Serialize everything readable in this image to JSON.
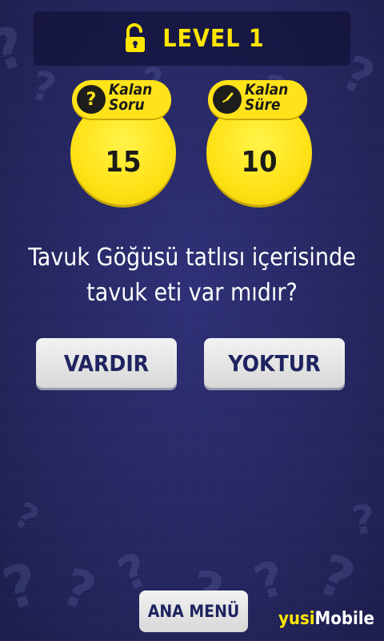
{
  "header": {
    "level_label": "LEVEL 1",
    "icon": "unlocked-padlock-icon"
  },
  "stats": {
    "questions": {
      "label_line1": "Kalan",
      "label_line2": "Soru",
      "icon": "question-mark-icon",
      "value": "15"
    },
    "time": {
      "label_line1": "Kalan",
      "label_line2": "Süre",
      "icon": "clock-icon",
      "value": "10"
    }
  },
  "question": {
    "line1": "Tavuk Göğüsü tatlısı içerisinde",
    "line2": "tavuk eti var mıdır?"
  },
  "answers": {
    "yes_label": "VARDIR",
    "no_label": "YOKTUR"
  },
  "footer": {
    "menu_label": "ANA MENÜ",
    "brand_part1": "yusi",
    "brand_part2": "Mobile"
  },
  "colors": {
    "accent_yellow": "#ffe31a",
    "background_navy": "#232461",
    "button_text": "#1f2360"
  }
}
